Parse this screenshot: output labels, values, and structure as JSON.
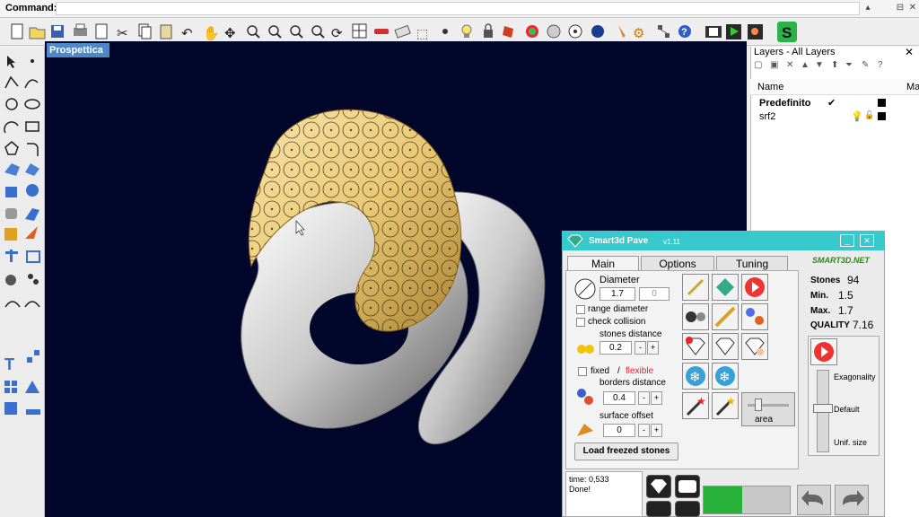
{
  "command": {
    "label": "Command:",
    "value": ""
  },
  "viewport": {
    "tab_label": "Prospettica",
    "background": "#03062b"
  },
  "layers": {
    "title": "Layers - All Layers",
    "columns": [
      "Name",
      "Mat"
    ],
    "rows": [
      {
        "name": "Predefinito",
        "current": "✔",
        "bold": true
      },
      {
        "name": "srf2",
        "current": "",
        "bold": false
      }
    ]
  },
  "smart3d": {
    "title": "Smart3d Pave",
    "version": "v1.11",
    "tabs": [
      "Main",
      "Options",
      "Tuning"
    ],
    "active_tab": "Main",
    "logo_text": "SMART3D.NET",
    "diameter": {
      "label": "Diameter",
      "value": "1.7",
      "second_value": "0"
    },
    "range_diameter_label": "range diameter",
    "check_collision_label": "check collision",
    "stones_distance": {
      "label": "stones distance",
      "value": "0.2"
    },
    "fixed_label": "fixed",
    "separator": "/",
    "flexible_label": "flexible",
    "borders_distance": {
      "label": "borders distance",
      "value": "0.4"
    },
    "surface_offset": {
      "label": "surface offset",
      "value": "0"
    },
    "minus": "-",
    "plus": "+",
    "load_button": "Load freezed stones",
    "area_label": "area",
    "stats": {
      "stones_label": "Stones",
      "stones_value": "94",
      "min_label": "Min.",
      "min_value": "1.5",
      "max_label": "Max.",
      "max_value": "1.7",
      "quality_label": "QUALITY",
      "quality_value": "7.16"
    },
    "slider_labels": {
      "top": "Exagonality",
      "mid": "Default",
      "bottom": "Unif. size"
    },
    "log": {
      "line1": "time: 0,533",
      "line2": "Done!"
    },
    "progress": 0.45,
    "accent": "#37c9cb"
  }
}
